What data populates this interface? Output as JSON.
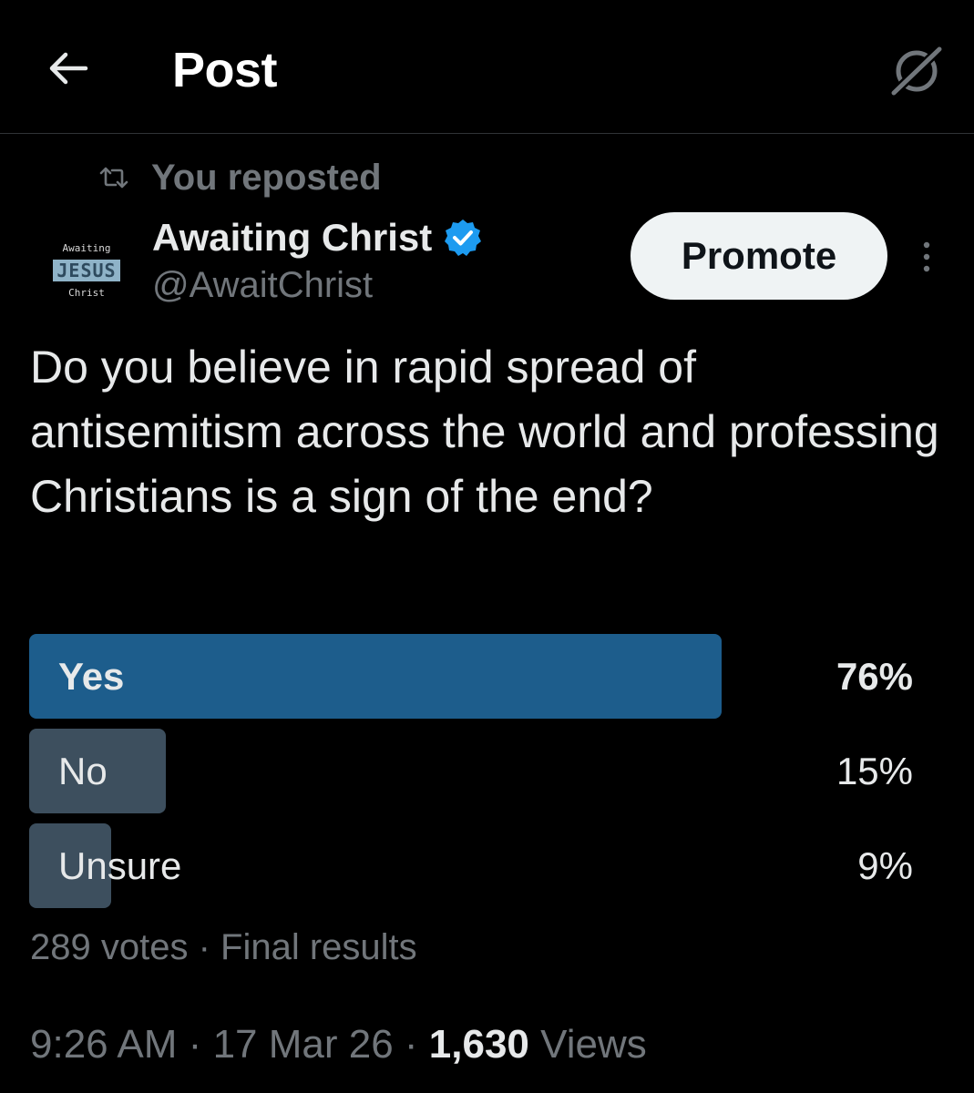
{
  "header": {
    "title": "Post",
    "back_icon": "arrow-left-icon",
    "grok_icon": "grok-icon"
  },
  "repost": {
    "text": "You reposted",
    "icon": "repost-icon"
  },
  "author": {
    "name": "Awaiting Christ",
    "handle": "@AwaitChrist",
    "verified": true,
    "avatar_text": {
      "top": "Awaiting",
      "middle": "JESUS",
      "bottom": "Christ"
    }
  },
  "actions": {
    "promote_label": "Promote",
    "more_icon": "more-vertical-icon"
  },
  "post": {
    "text": "Do you believe in rapid spread of antisemitism across the world and professing Christians is a sign of the end?"
  },
  "poll": {
    "options": [
      {
        "label": "Yes",
        "percent_text": "76%",
        "fraction": 0.76,
        "winner": true,
        "color": "#1d5d8c"
      },
      {
        "label": "No",
        "percent_text": "15%",
        "fraction": 0.15,
        "winner": false,
        "color": "#3d4f5e"
      },
      {
        "label": "Unsure",
        "percent_text": "9%",
        "fraction": 0.09,
        "winner": false,
        "color": "#3d4f5e"
      }
    ],
    "votes": "289 votes",
    "separator": "·",
    "status": "Final results"
  },
  "meta": {
    "time": "9:26 AM",
    "date": "17 Mar 26",
    "separator": "·",
    "views_count": "1,630",
    "views_label": "Views"
  },
  "colors": {
    "background": "#000000",
    "text": "#e7e9ea",
    "muted": "#71767b",
    "accent": "#1d9bf0"
  }
}
